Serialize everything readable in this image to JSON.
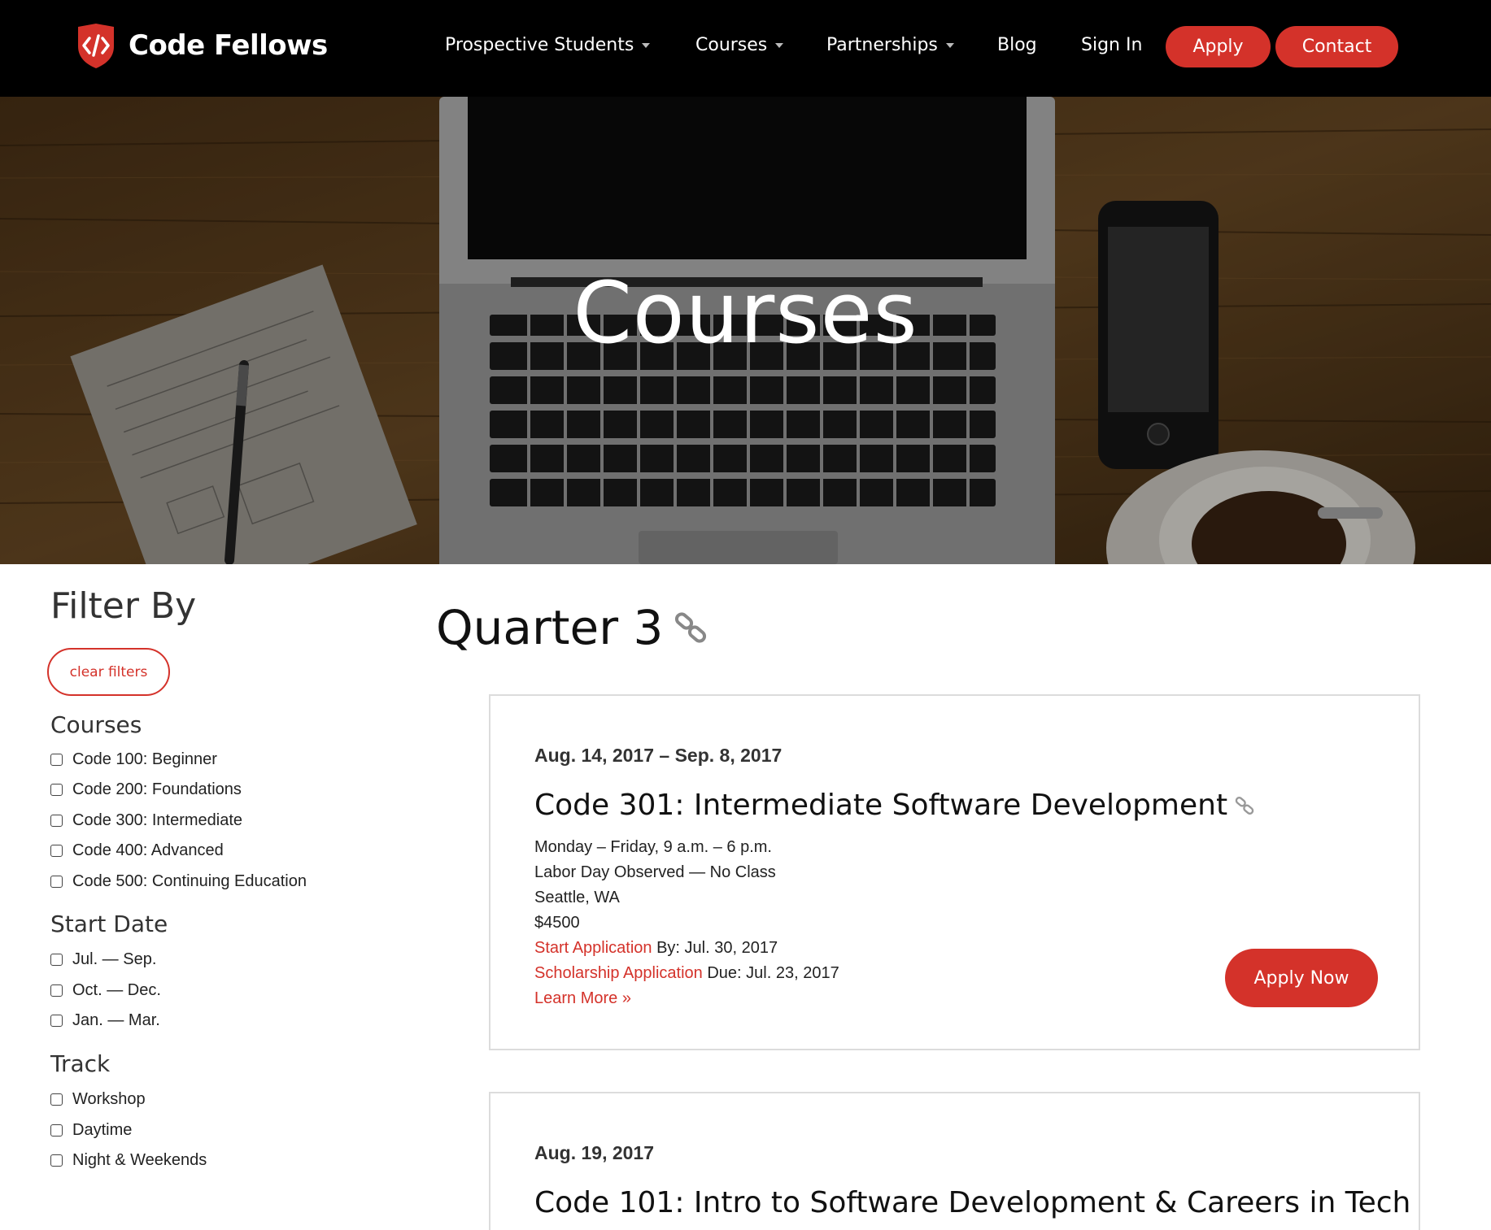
{
  "header": {
    "brand": "Code Fellows",
    "nav": [
      {
        "label": "Prospective Students",
        "dropdown": true
      },
      {
        "label": "Courses",
        "dropdown": true
      },
      {
        "label": "Partnerships",
        "dropdown": true
      },
      {
        "label": "Blog",
        "dropdown": false
      },
      {
        "label": "Sign In",
        "dropdown": false
      }
    ],
    "apply_label": "Apply",
    "contact_label": "Contact",
    "colors": {
      "brand_red": "#d4322a",
      "bar": "#000000"
    }
  },
  "hero": {
    "title": "Courses",
    "image_icon": "laptop-desk-photo"
  },
  "sidebar": {
    "title": "Filter By",
    "clear_label": "clear filters",
    "groups": [
      {
        "title": "Courses",
        "options": [
          "Code 100: Beginner",
          "Code 200: Foundations",
          "Code 300: Intermediate",
          "Code 400: Advanced",
          "Code 500: Continuing Education"
        ]
      },
      {
        "title": "Start Date",
        "options": [
          "Jul. — Sep.",
          "Oct. — Dec.",
          "Jan. — Mar."
        ]
      },
      {
        "title": "Track",
        "options": [
          "Workshop",
          "Daytime",
          "Night & Weekends"
        ]
      }
    ]
  },
  "main": {
    "section_title": "Quarter 3",
    "section_icon": "link-icon",
    "courses": [
      {
        "date": "Aug. 14, 2017 – Sep. 8, 2017",
        "title": "Code 301: Intermediate Software Development",
        "schedule": "Monday – Friday, 9 a.m. – 6 p.m.",
        "note": "Labor Day Observed — No Class",
        "location": "Seattle, WA",
        "price": "$4500",
        "start_app_link": "Start Application",
        "start_app_rest": " By: Jul. 30, 2017",
        "scholarship_link": "Scholarship Application",
        "scholarship_rest": " Due: Jul. 23, 2017",
        "learn_more": "Learn More »",
        "apply_label": "Apply Now"
      },
      {
        "date": "Aug. 19, 2017",
        "title": "Code 101: Intro to Software Development & Careers in Tech"
      }
    ]
  }
}
